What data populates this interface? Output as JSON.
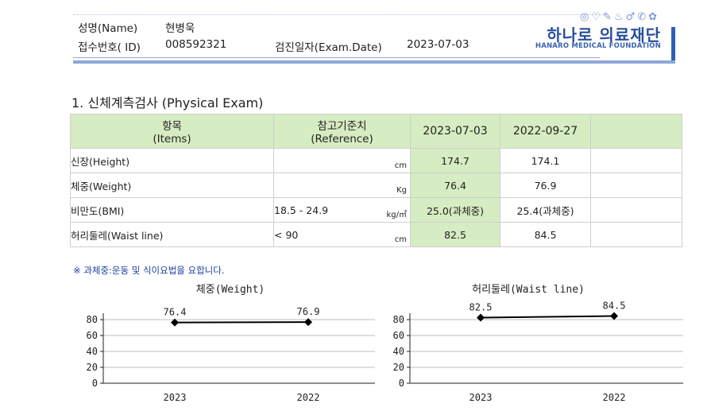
{
  "header": {
    "name_label": "성명(Name)",
    "name_value": "현병욱",
    "id_label": "접수번호( ID)",
    "id_value": "008592321",
    "exam_date_label": "검진일자(Exam.Date)",
    "exam_date_value": "2023-07-03",
    "logo_icons": "◎♡✎♨♂✆✿",
    "logo_korean": "하나로 의료재단",
    "logo_english": "HANARO MEDICAL FOUNDATION"
  },
  "section": {
    "title": "1. 신체계측검사 (Physical Exam)"
  },
  "table": {
    "col_items_ko": "항목",
    "col_items_en": "(Items)",
    "col_ref_ko": "참고기준치",
    "col_ref_en": "(Reference)",
    "col_date1": "2023-07-03",
    "col_date2": "2022-09-27",
    "rows": [
      {
        "item": "신장(Height)",
        "ref": "",
        "unit": "cm",
        "v1": "174.7",
        "v2": "174.1"
      },
      {
        "item": "체중(Weight)",
        "ref": "",
        "unit": "Kg",
        "v1": "76.4",
        "v2": "76.9"
      },
      {
        "item": "비만도(BMI)",
        "ref": "18.5 - 24.9",
        "unit": "kg/㎡",
        "v1": "25.0(과체중)",
        "v2": "25.4(과체중)"
      },
      {
        "item": "허리둘레(Waist line)",
        "ref": "< 90",
        "unit": "cm",
        "v1": "82.5",
        "v2": "84.5"
      }
    ]
  },
  "note": "※ 과체중:운동 및 식이요법을 요합니다.",
  "chart_data": [
    {
      "type": "line",
      "title": "체중(Weight)",
      "categories": [
        "2023",
        "2022"
      ],
      "series": [
        {
          "values": [
            76.4,
            76.9
          ]
        }
      ],
      "data_labels": [
        "76.4",
        "76.9"
      ],
      "yticks": [
        "0",
        "20",
        "40",
        "60",
        "80"
      ],
      "ylim": [
        0,
        80
      ],
      "grid": true,
      "color": "#000000"
    },
    {
      "type": "line",
      "title": "허리둘레(Waist line)",
      "categories": [
        "2023",
        "2022"
      ],
      "series": [
        {
          "values": [
            82.5,
            84.5
          ]
        }
      ],
      "data_labels": [
        "82.5",
        "84.5"
      ],
      "yticks": [
        "0",
        "20",
        "40",
        "60",
        "80"
      ],
      "ylim": [
        0,
        80
      ],
      "grid": true,
      "color": "#000000"
    }
  ]
}
